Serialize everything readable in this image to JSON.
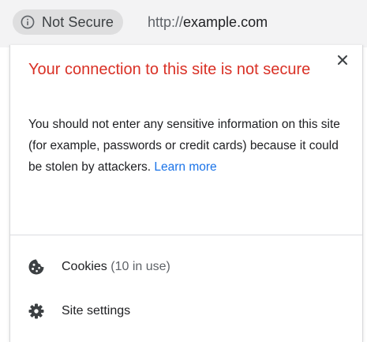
{
  "address_bar": {
    "security_label": "Not Secure",
    "url_scheme": "http://",
    "url_host": "example.com"
  },
  "popup": {
    "title": "Your connection to this site is not secure",
    "description": "You should not enter any sensitive information on this site (for example, passwords or credit cards) because it could be stolen by attackers.",
    "learn_more_label": "Learn more",
    "menu": [
      {
        "label": "Cookies",
        "detail": "(10 in use)",
        "icon": "cookie-icon"
      },
      {
        "label": "Site settings",
        "detail": "",
        "icon": "gear-icon"
      }
    ]
  },
  "colors": {
    "warning": "#d93025",
    "link": "#1a73e8",
    "chip_bg": "#dededf"
  }
}
